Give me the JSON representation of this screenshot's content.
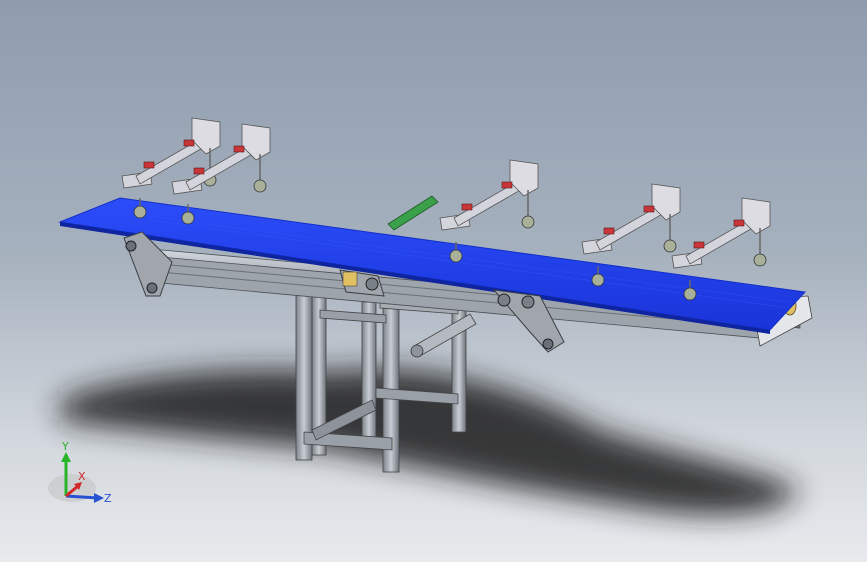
{
  "viewport": {
    "background_top": "#8e9cae",
    "background_bottom": "#e8eaed"
  },
  "model": {
    "belt_color": "#1f3ff0",
    "belt_edge_color": "#1330c8",
    "frame_color": "#b9bec6",
    "frame_dark": "#5d636b",
    "bracket_color": "#d4d4dc",
    "clamp_color": "#c8363a",
    "guide_color": "#3aa14a",
    "caster_color": "#a8b09a",
    "roller_color": "#e0c060",
    "shadow_color": "#1a1a1a"
  },
  "triad": {
    "label_y": "Y",
    "label_x": "X",
    "label_z": "Z",
    "color_y": "#28b428",
    "color_x": "#d22828",
    "color_z": "#2850d2"
  },
  "icons": {
    "triad": "coordinate-triad-icon"
  }
}
